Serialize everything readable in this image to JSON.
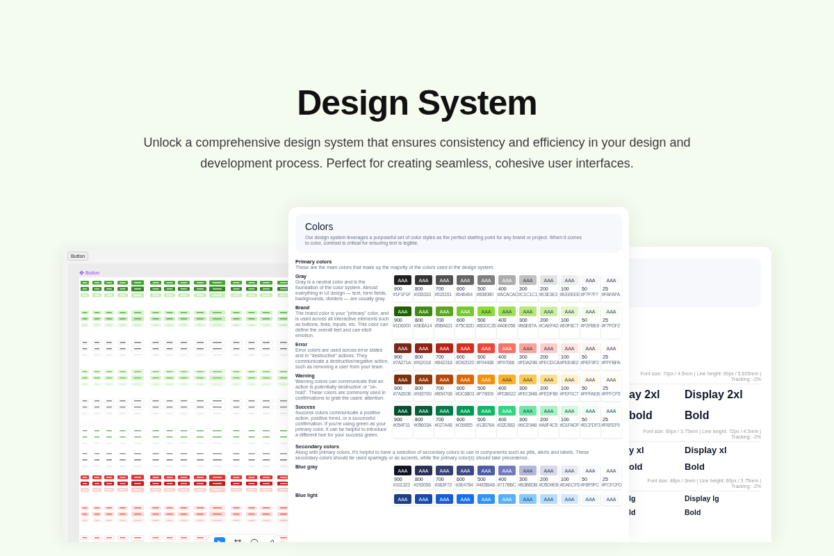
{
  "hero": {
    "title": "Design System",
    "subtitle": "Unlock a comprehensive design system that ensures consistency and efficiency in your design and development process. Perfect for creating seamless, cohesive user interfaces."
  },
  "button_card": {
    "tab": "Button",
    "component_label": "Button"
  },
  "colors_card": {
    "title": "Colors",
    "description": "Our design system leverages a purposeful set of color styles as the perfect starting point for any brand or project. When it comes to color, contrast is critical for ensuring text is legible.",
    "sections": [
      {
        "title": "Primary colors",
        "description": "These are the main colors that make up the majority of the colors used in the design system.",
        "groups": [
          {
            "name": "Gray",
            "description": "Gray is a neutral color and is the foundation of the color system. Almost everything in UI design — text, form fields, backgrounds, dividers — are usually gray.",
            "swatches": [
              {
                "sample": "AAA",
                "shade": "900",
                "hex": "#1F1F1F",
                "color": "#1f1f1f"
              },
              {
                "sample": "AAA",
                "shade": "800",
                "hex": "#333333",
                "color": "#333333"
              },
              {
                "sample": "AAA",
                "shade": "700",
                "hex": "#515151",
                "color": "#515151"
              },
              {
                "sample": "AAA",
                "shade": "600",
                "hex": "#646464",
                "color": "#646464"
              },
              {
                "sample": "AAA",
                "shade": "500",
                "hex": "#808080",
                "color": "#808080"
              },
              {
                "sample": "AAA",
                "shade": "400",
                "hex": "#ACACAC",
                "color": "#acacac"
              },
              {
                "sample": "AAA",
                "shade": "300",
                "hex": "#C1C1C1",
                "color": "#c1c1c1"
              },
              {
                "sample": "AAA",
                "shade": "200",
                "hex": "#E3E3E3",
                "color": "#e3e3e3"
              },
              {
                "sample": "AAA",
                "shade": "100",
                "hex": "#EEEEEE",
                "color": "#eeeeee"
              },
              {
                "sample": "AAA",
                "shade": "50",
                "hex": "#F7F7F7",
                "color": "#f7f7f7"
              },
              {
                "sample": "AAA",
                "shade": "25",
                "hex": "#FAFAFA",
                "color": "#fafafa"
              }
            ]
          },
          {
            "name": "Brand",
            "description": "The brand color is your \"primary\" color, and is used across all interactive elements such as buttons, links, inputs, etc. This color can define the overall feel and can elicit emotion.",
            "swatches": [
              {
                "sample": "AAA",
                "shade": "900",
                "hex": "#1D6000",
                "color": "#1d6000"
              },
              {
                "sample": "AAA",
                "shade": "800",
                "hex": "#3E8A14",
                "color": "#3e8a14"
              },
              {
                "sample": "AAA",
                "shade": "700",
                "hex": "#5BA621",
                "color": "#5ba621"
              },
              {
                "sample": "AAA",
                "shade": "600",
                "hex": "#75C82D",
                "color": "#75c82d"
              },
              {
                "sample": "AAA",
                "shade": "500",
                "hex": "#8DDC35",
                "color": "#8ddc35"
              },
              {
                "sample": "AAA",
                "shade": "400",
                "hex": "#A0E058",
                "color": "#a0e058"
              },
              {
                "sample": "AAA",
                "shade": "300",
                "hex": "#B6E87A",
                "color": "#b6e87a"
              },
              {
                "sample": "AAA",
                "shade": "200",
                "hex": "#CAEFA2",
                "color": "#caefa2"
              },
              {
                "sample": "AAA",
                "shade": "100",
                "hex": "#E0F6C7",
                "color": "#e0f6c7"
              },
              {
                "sample": "AAA",
                "shade": "50",
                "hex": "#F2FBE9",
                "color": "#f2fbe9"
              },
              {
                "sample": "AAA",
                "shade": "25",
                "hex": "#F7FDF2",
                "color": "#f7fdf2"
              }
            ]
          },
          {
            "name": "Error",
            "description": "Error colors are used across error states and in \"destructive\" actions. They communicate a destructive/negative action, such as removing a user from your team.",
            "swatches": [
              {
                "sample": "AAA",
                "shade": "900",
                "hex": "#7A271A",
                "color": "#7a271a"
              },
              {
                "sample": "AAA",
                "shade": "800",
                "hex": "#912018",
                "color": "#912018"
              },
              {
                "sample": "AAA",
                "shade": "700",
                "hex": "#B42318",
                "color": "#b42318"
              },
              {
                "sample": "AAA",
                "shade": "600",
                "hex": "#D92D20",
                "color": "#d92d20"
              },
              {
                "sample": "AAA",
                "shade": "500",
                "hex": "#F04438",
                "color": "#f04438"
              },
              {
                "sample": "AAA",
                "shade": "400",
                "hex": "#F97066",
                "color": "#f97066"
              },
              {
                "sample": "AAA",
                "shade": "300",
                "hex": "#FDA29B",
                "color": "#fda29b"
              },
              {
                "sample": "AAA",
                "shade": "200",
                "hex": "#FECDCA",
                "color": "#fecdca"
              },
              {
                "sample": "AAA",
                "shade": "100",
                "hex": "#FEE4E2",
                "color": "#fee4e2"
              },
              {
                "sample": "AAA",
                "shade": "50",
                "hex": "#FEF3F2",
                "color": "#fef3f2"
              },
              {
                "sample": "AAA",
                "shade": "25",
                "hex": "#FFFBFA",
                "color": "#fffbfa"
              }
            ]
          },
          {
            "name": "Warning",
            "description": "Warning colors can communicate that an action is potentially destructive or \"on-hold\". These colors are commonly used in confirmations to grab the users' attention.",
            "swatches": [
              {
                "sample": "AAA",
                "shade": "900",
                "hex": "#7A2E0E",
                "color": "#7a2e0e"
              },
              {
                "sample": "AAA",
                "shade": "800",
                "hex": "#93370D",
                "color": "#93370d"
              },
              {
                "sample": "AAA",
                "shade": "700",
                "hex": "#B54708",
                "color": "#b54708"
              },
              {
                "sample": "AAA",
                "shade": "600",
                "hex": "#DC6803",
                "color": "#dc6803"
              },
              {
                "sample": "AAA",
                "shade": "500",
                "hex": "#F79009",
                "color": "#f79009"
              },
              {
                "sample": "AAA",
                "shade": "400",
                "hex": "#FDB022",
                "color": "#fdb022"
              },
              {
                "sample": "AAA",
                "shade": "300",
                "hex": "#FEC84B",
                "color": "#fec84b"
              },
              {
                "sample": "AAA",
                "shade": "200",
                "hex": "#FEDF89",
                "color": "#fedf89"
              },
              {
                "sample": "AAA",
                "shade": "100",
                "hex": "#FEF0C7",
                "color": "#fef0c7"
              },
              {
                "sample": "AAA",
                "shade": "50",
                "hex": "#FFFAEB",
                "color": "#fffaeb"
              },
              {
                "sample": "AAA",
                "shade": "25",
                "hex": "#FFFCF5",
                "color": "#fffcf5"
              }
            ]
          },
          {
            "name": "Success",
            "description": "Success colors communicate a positive action, positive trend, or a successful confirmation. If you're using green as your primary color, it can be helpful to introduce a different hue for your success green.",
            "swatches": [
              {
                "sample": "AAA",
                "shade": "900",
                "hex": "#054F31",
                "color": "#054f31"
              },
              {
                "sample": "AAA",
                "shade": "800",
                "hex": "#05603A",
                "color": "#05603a"
              },
              {
                "sample": "AAA",
                "shade": "700",
                "hex": "#027A48",
                "color": "#027a48"
              },
              {
                "sample": "AAA",
                "shade": "600",
                "hex": "#039855",
                "color": "#039855"
              },
              {
                "sample": "AAA",
                "shade": "500",
                "hex": "#12B76A",
                "color": "#12b76a"
              },
              {
                "sample": "AAA",
                "shade": "400",
                "hex": "#32D583",
                "color": "#32d583"
              },
              {
                "sample": "AAA",
                "shade": "300",
                "hex": "#6CE9A6",
                "color": "#6ce9a6"
              },
              {
                "sample": "AAA",
                "shade": "200",
                "hex": "#A6F4C5",
                "color": "#a6f4c5"
              },
              {
                "sample": "AAA",
                "shade": "100",
                "hex": "#D1FADF",
                "color": "#d1fadf"
              },
              {
                "sample": "AAA",
                "shade": "50",
                "hex": "#ECFDF3",
                "color": "#ecfdf3"
              },
              {
                "sample": "AAA",
                "shade": "25",
                "hex": "#F6FEF9",
                "color": "#f6fef9"
              }
            ]
          }
        ]
      },
      {
        "title": "Secondary colors",
        "description": "Along with primary colors, it's helpful to have a selection of secondary colors to use in components such as pills, alerts and labels. These secondary colors should be used sparingly or as accents, while the primary color(s) should take precedence.",
        "groups": [
          {
            "name": "Blue gray",
            "swatches": [
              {
                "sample": "AAA",
                "shade": "900",
                "hex": "#101323",
                "color": "#101323"
              },
              {
                "sample": "AAA",
                "shade": "800",
                "hex": "#293056",
                "color": "#293056"
              },
              {
                "sample": "AAA",
                "shade": "700",
                "hex": "#363F72",
                "color": "#363f72"
              },
              {
                "sample": "AAA",
                "shade": "600",
                "hex": "#3E4784",
                "color": "#3e4784"
              },
              {
                "sample": "AAA",
                "shade": "500",
                "hex": "#4E5BA6",
                "color": "#4e5ba6"
              },
              {
                "sample": "AAA",
                "shade": "400",
                "hex": "#717BBC",
                "color": "#717bbc"
              },
              {
                "sample": "AAA",
                "shade": "300",
                "hex": "#B3B8DB",
                "color": "#b3b8db"
              },
              {
                "sample": "AAA",
                "shade": "200",
                "hex": "#D5D9EB",
                "color": "#d5d9eb"
              },
              {
                "sample": "AAA",
                "shade": "100",
                "hex": "#EAECF5",
                "color": "#eaecf5"
              },
              {
                "sample": "AAA",
                "shade": "50",
                "hex": "#F8F9FC",
                "color": "#f8f9fc"
              },
              {
                "sample": "AAA",
                "shade": "25",
                "hex": "#FCFCFD",
                "color": "#fcfcfd"
              }
            ]
          },
          {
            "name": "Blue light",
            "swatches": [
              {
                "sample": "AAA",
                "color": "#194185"
              },
              {
                "sample": "AAA",
                "color": "#1849a9"
              },
              {
                "sample": "AAA",
                "color": "#175cd3"
              },
              {
                "sample": "AAA",
                "color": "#1570ef"
              },
              {
                "sample": "AAA",
                "color": "#2e90fa"
              },
              {
                "sample": "AAA",
                "color": "#53b1fd"
              },
              {
                "sample": "AAA",
                "color": "#84caff"
              },
              {
                "sample": "AAA",
                "color": "#b2ddff"
              },
              {
                "sample": "AAA",
                "color": "#d1e9ff"
              },
              {
                "sample": "AAA",
                "color": "#eff8ff"
              },
              {
                "sample": "AAA",
                "color": "#f5faff"
              }
            ]
          }
        ]
      }
    ]
  },
  "typography_card": {
    "styles": [
      {
        "kind": "huge",
        "spec": "Font size: 72px / 4.5rem | Line height: 90px / 5.625rem | Tracking: -2%",
        "lines": [
          {
            "left": "ay 2xl",
            "right": "Display 2xl"
          },
          {
            "left": "bold",
            "right": "Bold"
          }
        ]
      },
      {
        "kind": "large",
        "spec": "Font size: 60px / 3.75rem | Line height: 72px / 4.5rem | Tracking: -2%",
        "lines": [
          {
            "left": "y xl",
            "right": "Display xl"
          },
          {
            "left": "old",
            "right": "Bold"
          }
        ]
      },
      {
        "kind": "medium",
        "spec": "Font size: 48px / 3rem | Line height: 60px / 3.75rem | Tracking: -2%",
        "lines": [
          {
            "left": "lg",
            "right": "Display lg"
          },
          {
            "left": "ld",
            "right": "Bold"
          }
        ]
      }
    ]
  }
}
